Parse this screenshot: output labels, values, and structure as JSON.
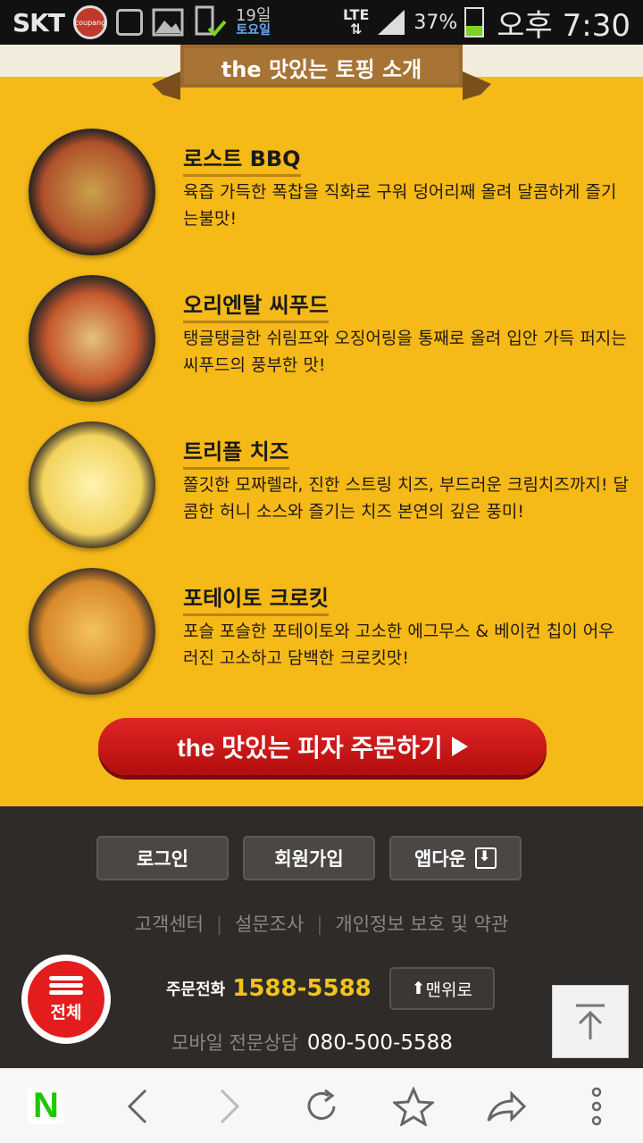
{
  "status_bar": {
    "carrier": "SKT",
    "coupang_badge": "coupang",
    "date_day": "19일",
    "date_weekday": "토요일",
    "network": "LTE",
    "battery_percent": "37%",
    "battery_level": 0.37,
    "time": "오후 7:30"
  },
  "section": {
    "header": "the 맛있는 토핑 소개"
  },
  "toppings": [
    {
      "title": "로스트 BBQ",
      "desc": "육즙 가득한 폭찹을 직화로 구워 덩어리째 올려 달콤하게 즐기는불맛!"
    },
    {
      "title": "오리엔탈 씨푸드",
      "desc": "탱글탱글한 쉬림프와 오징어링을 통째로 올려 입안 가득 퍼지는 씨푸드의 풍부한 맛!"
    },
    {
      "title": "트리플 치즈",
      "desc": "쫄깃한 모짜렐라, 진한 스트링 치즈, 부드러운 크림치즈까지! 달콤한 허니 소스와 즐기는 치즈 본연의 깊은 풍미!"
    },
    {
      "title": "포테이토 크로킷",
      "desc": "포슬 포슬한 포테이토와 고소한 에그무스 & 베이컨 칩이 어우러진 고소하고 담백한 크로킷맛!"
    }
  ],
  "order_button": {
    "label": "the 맛있는 피자 주문하기"
  },
  "footer": {
    "login": "로그인",
    "signup": "회원가입",
    "app_download": "앱다운",
    "links": [
      "고객센터",
      "설문조사",
      "개인정보 보호 및 약관"
    ],
    "all_menu": "전체",
    "order_phone_label": "주문전화",
    "order_phone": "1588-5588",
    "to_top": "맨위로",
    "mobile_label": "모바일 전문상담",
    "mobile_phone": "080-500-5588"
  },
  "browser_bar": {
    "home_logo": "N"
  },
  "colors": {
    "main_bg": "#f5b918",
    "footer_bg": "#2e2b29",
    "order_red": "#e02525",
    "phone_yellow": "#f3c21a",
    "naver_green": "#1ec800"
  }
}
